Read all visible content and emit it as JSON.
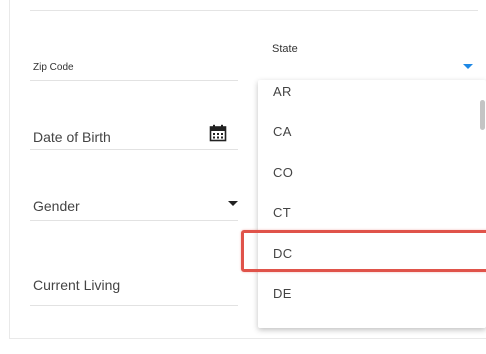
{
  "form": {
    "zip_code_label": "Zip Code",
    "date_of_birth_label": "Date of Birth",
    "gender_label": "Gender",
    "current_living_label": "Current Living",
    "state_label": "State"
  },
  "state_dropdown": {
    "options": [
      "AR",
      "CA",
      "CO",
      "CT",
      "DC",
      "DE"
    ],
    "highlighted_option": "DC"
  },
  "icons": {
    "calendar": "calendar-icon",
    "state_caret": "chevron-down-icon",
    "gender_caret": "chevron-down-icon"
  },
  "colors": {
    "accent": "#1e88e5",
    "highlight_border": "#e0534a"
  }
}
